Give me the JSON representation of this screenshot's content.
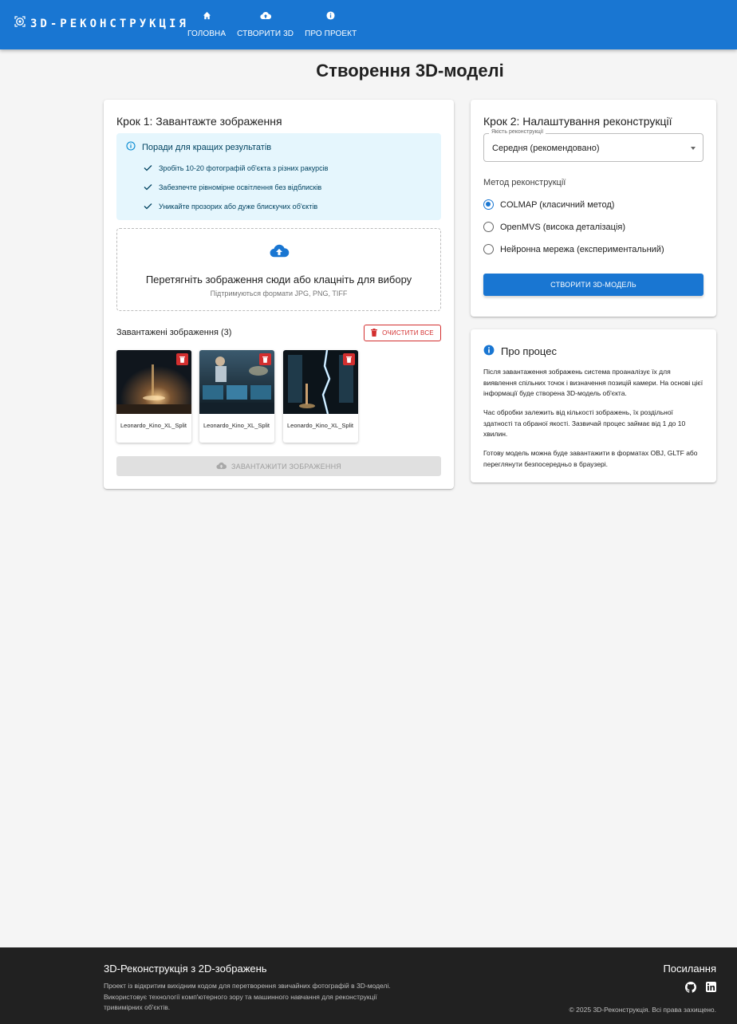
{
  "header": {
    "brand": "3D-РЕКОНСТРУКЦІЯ",
    "nav": [
      {
        "label": "ГОЛОВНА",
        "icon": "home-icon"
      },
      {
        "label": "СТВОРИТИ 3D",
        "icon": "cloud-upload-icon"
      },
      {
        "label": "ПРО ПРОЕКТ",
        "icon": "info-icon"
      }
    ]
  },
  "page": {
    "title": "Створення 3D-моделі"
  },
  "step1": {
    "title": "Крок 1: Завантажте зображення",
    "tips": {
      "heading": "Поради для кращих результатів",
      "items": [
        "Зробіть 10-20 фотографій об'єкта з різних ракурсів",
        "Забезпечте рівномірне освітлення без відблисків",
        "Уникайте прозорих або дуже блискучих об'єктів"
      ]
    },
    "dropzone": {
      "main": "Перетягніть зображення сюди або клацніть для вибору",
      "sub": "Підтримуються формати JPG, PNG, TIFF"
    },
    "uploaded_label": "Завантажені зображення (3)",
    "clear_label": "ОЧИСТИТИ ВСЕ",
    "images": [
      {
        "name": "Leonardo_Kino_XL_Split"
      },
      {
        "name": "Leonardo_Kino_XL_Split"
      },
      {
        "name": "Leonardo_Kino_XL_Split"
      }
    ],
    "upload_label": "ЗАВАНТАЖИТИ ЗОБРАЖЕННЯ"
  },
  "step2": {
    "title": "Крок 2: Налаштування реконструкції",
    "quality_legend": "Якість реконструкції",
    "quality_value": "Середня (рекомендовано)",
    "method_label": "Метод реконструкції",
    "methods": [
      {
        "label": "COLMAP (класичний метод)",
        "selected": true
      },
      {
        "label": "OpenMVS (висока деталізація)",
        "selected": false
      },
      {
        "label": "Нейронна мережа (експериментальний)",
        "selected": false
      }
    ],
    "create_label": "СТВОРИТИ 3D-МОДЕЛЬ"
  },
  "about": {
    "title": "Про процес",
    "paragraphs": [
      "Після завантаження зображень система проаналізує їх для виявлення спільних точок і визначення позицій камери. На основі цієї інформації буде створена 3D-модель об'єкта.",
      "Час обробки залежить від кількості зображень, їх роздільної здатності та обраної якості. Зазвичай процес займає від 1 до 10 хвилин.",
      "Готову модель можна буде завантажити в форматах OBJ, GLTF або переглянути безпосередньо в браузері."
    ]
  },
  "footer": {
    "title": "3D-Реконструкція з 2D-зображень",
    "description": "Проект із відкритим вихідним кодом для перетворення звичайних фотографій в 3D-моделі. Використовує технології комп'ютерного зору та машинного навчання для реконструкції тривимірних об'єктів.",
    "links_title": "Посилання",
    "copyright": "© 2025 3D-Реконструкція. Всі права захищено."
  },
  "colors": {
    "primary": "#1976d2",
    "danger": "#d32f2f",
    "footer": "#212121",
    "tip_bg": "#e5f6fd"
  }
}
